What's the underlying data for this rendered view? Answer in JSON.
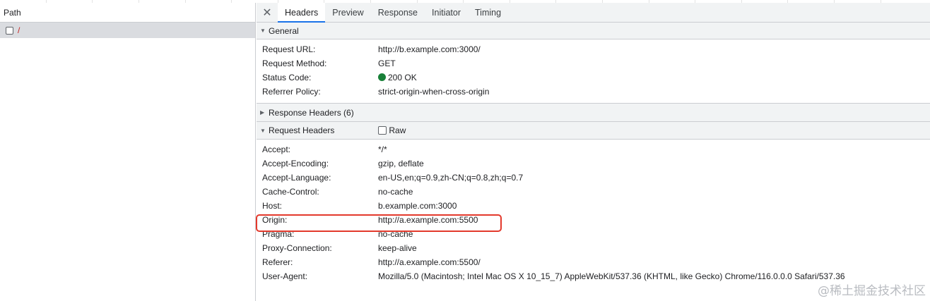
{
  "left_panel": {
    "header": "Path",
    "rows": [
      {
        "name": "/"
      }
    ]
  },
  "tabs": [
    {
      "label": "Headers",
      "active": true
    },
    {
      "label": "Preview",
      "active": false
    },
    {
      "label": "Response",
      "active": false
    },
    {
      "label": "Initiator",
      "active": false
    },
    {
      "label": "Timing",
      "active": false
    }
  ],
  "general": {
    "title": "General",
    "rows": [
      {
        "key": "Request URL:",
        "value": "http://b.example.com:3000/"
      },
      {
        "key": "Request Method:",
        "value": "GET"
      },
      {
        "key": "Status Code:",
        "value": "200 OK"
      },
      {
        "key": "Referrer Policy:",
        "value": "strict-origin-when-cross-origin"
      }
    ]
  },
  "response_headers": {
    "title": "Response Headers (6)"
  },
  "request_headers": {
    "title": "Request Headers",
    "raw_label": "Raw",
    "rows": [
      {
        "key": "Accept:",
        "value": "*/*"
      },
      {
        "key": "Accept-Encoding:",
        "value": "gzip, deflate"
      },
      {
        "key": "Accept-Language:",
        "value": "en-US,en;q=0.9,zh-CN;q=0.8,zh;q=0.7"
      },
      {
        "key": "Cache-Control:",
        "value": "no-cache"
      },
      {
        "key": "Host:",
        "value": "b.example.com:3000"
      },
      {
        "key": "Origin:",
        "value": "http://a.example.com:5500"
      },
      {
        "key": "Pragma:",
        "value": "no-cache"
      },
      {
        "key": "Proxy-Connection:",
        "value": "keep-alive"
      },
      {
        "key": "Referer:",
        "value": "http://a.example.com:5500/"
      },
      {
        "key": "User-Agent:",
        "value": "Mozilla/5.0 (Macintosh; Intel Mac OS X 10_15_7) AppleWebKit/537.36 (KHTML, like Gecko) Chrome/116.0.0.0 Safari/537.36"
      }
    ]
  },
  "colors": {
    "status_ok": "#188038",
    "highlight": "#e3392c",
    "active_tab": "#1a73e8"
  },
  "watermark": "@稀土掘金技术社区"
}
